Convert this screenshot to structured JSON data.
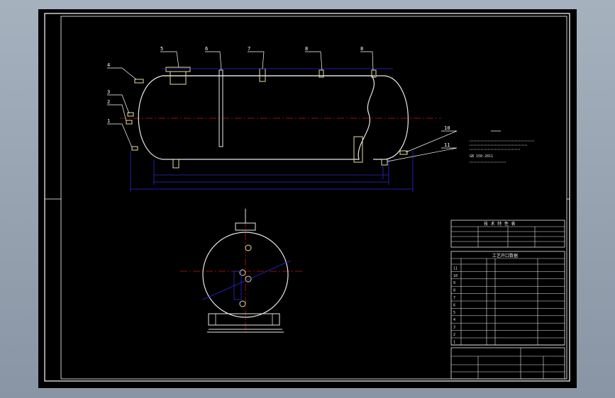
{
  "colors": {
    "background": "#000000",
    "border": "#ffffff",
    "dimension": "#2a2ad8",
    "centerline": "#d01010",
    "outline": "#e8e8e8",
    "nozzle": "#e8e0a0",
    "leader": "#ffffff"
  },
  "callouts": [
    "5",
    "6",
    "7",
    "8",
    "8",
    "4",
    "3",
    "2",
    "1",
    "10",
    "11"
  ],
  "tables": {
    "design_header": "技 术 特 性 表",
    "nozzle_title": "工艺开口数据",
    "nozzle_rows": [
      "11",
      "10",
      "9",
      "8",
      "7",
      "6",
      "5",
      "4",
      "3",
      "2",
      "1"
    ],
    "standard_note": "GB 150-2011"
  }
}
